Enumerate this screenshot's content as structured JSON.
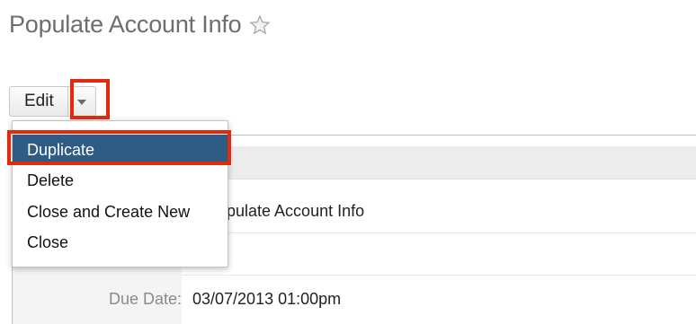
{
  "record": {
    "title": "Populate Account Info",
    "subject_value": "pulate Account Info",
    "due_date_label": "Due Date:",
    "due_date_value": "03/07/2013 01:00pm"
  },
  "toolbar": {
    "edit_label": "Edit"
  },
  "menu": {
    "items": [
      "Duplicate",
      "Delete",
      "Close and Create New",
      "Close"
    ],
    "selected": "Duplicate"
  },
  "colors": {
    "highlight": "#e12b0f",
    "menu_selected_bg": "#2f5c84"
  }
}
